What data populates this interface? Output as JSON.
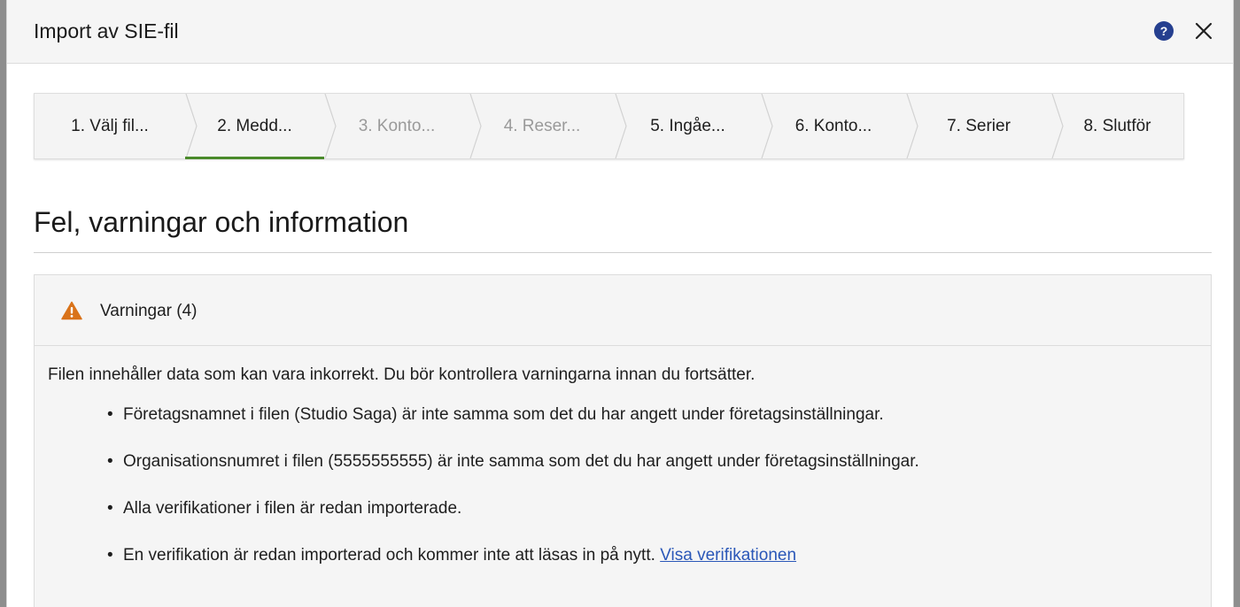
{
  "dialog": {
    "title": "Import av SIE-fil",
    "help_icon": "question-circle-icon",
    "close_icon": "close-icon"
  },
  "stepper": {
    "active_color": "#4a8a2a",
    "steps": [
      {
        "label": "1. Välj fil...",
        "state": "done"
      },
      {
        "label": "2. Medd...",
        "state": "active"
      },
      {
        "label": "3. Konto...",
        "state": "disabled"
      },
      {
        "label": "4. Reser...",
        "state": "disabled"
      },
      {
        "label": "5. Ingåe...",
        "state": "enabled"
      },
      {
        "label": "6. Konto...",
        "state": "enabled"
      },
      {
        "label": "7. Serier",
        "state": "enabled"
      },
      {
        "label": "8. Slutför",
        "state": "enabled"
      }
    ]
  },
  "section": {
    "title": "Fel, varningar och information"
  },
  "warnings": {
    "icon": "warning-triangle-icon",
    "icon_color": "#d9731a",
    "title": "Varningar (4)",
    "intro": "Filen innehåller data som kan vara inkorrekt. Du bör kontrollera varningarna innan du fortsätter.",
    "items": [
      {
        "text": "Företagsnamnet i filen (Studio Saga) är inte samma som det du har angett under företagsinställningar."
      },
      {
        "text": "Organisationsnumret i filen (5555555555) är inte samma som det du har angett under företagsinställningar."
      },
      {
        "text": "Alla verifikationer i filen är redan importerade."
      },
      {
        "text": "En verifikation är redan importerad och kommer inte att läsas in på nytt.",
        "link": "Visa verifikationen"
      }
    ]
  }
}
